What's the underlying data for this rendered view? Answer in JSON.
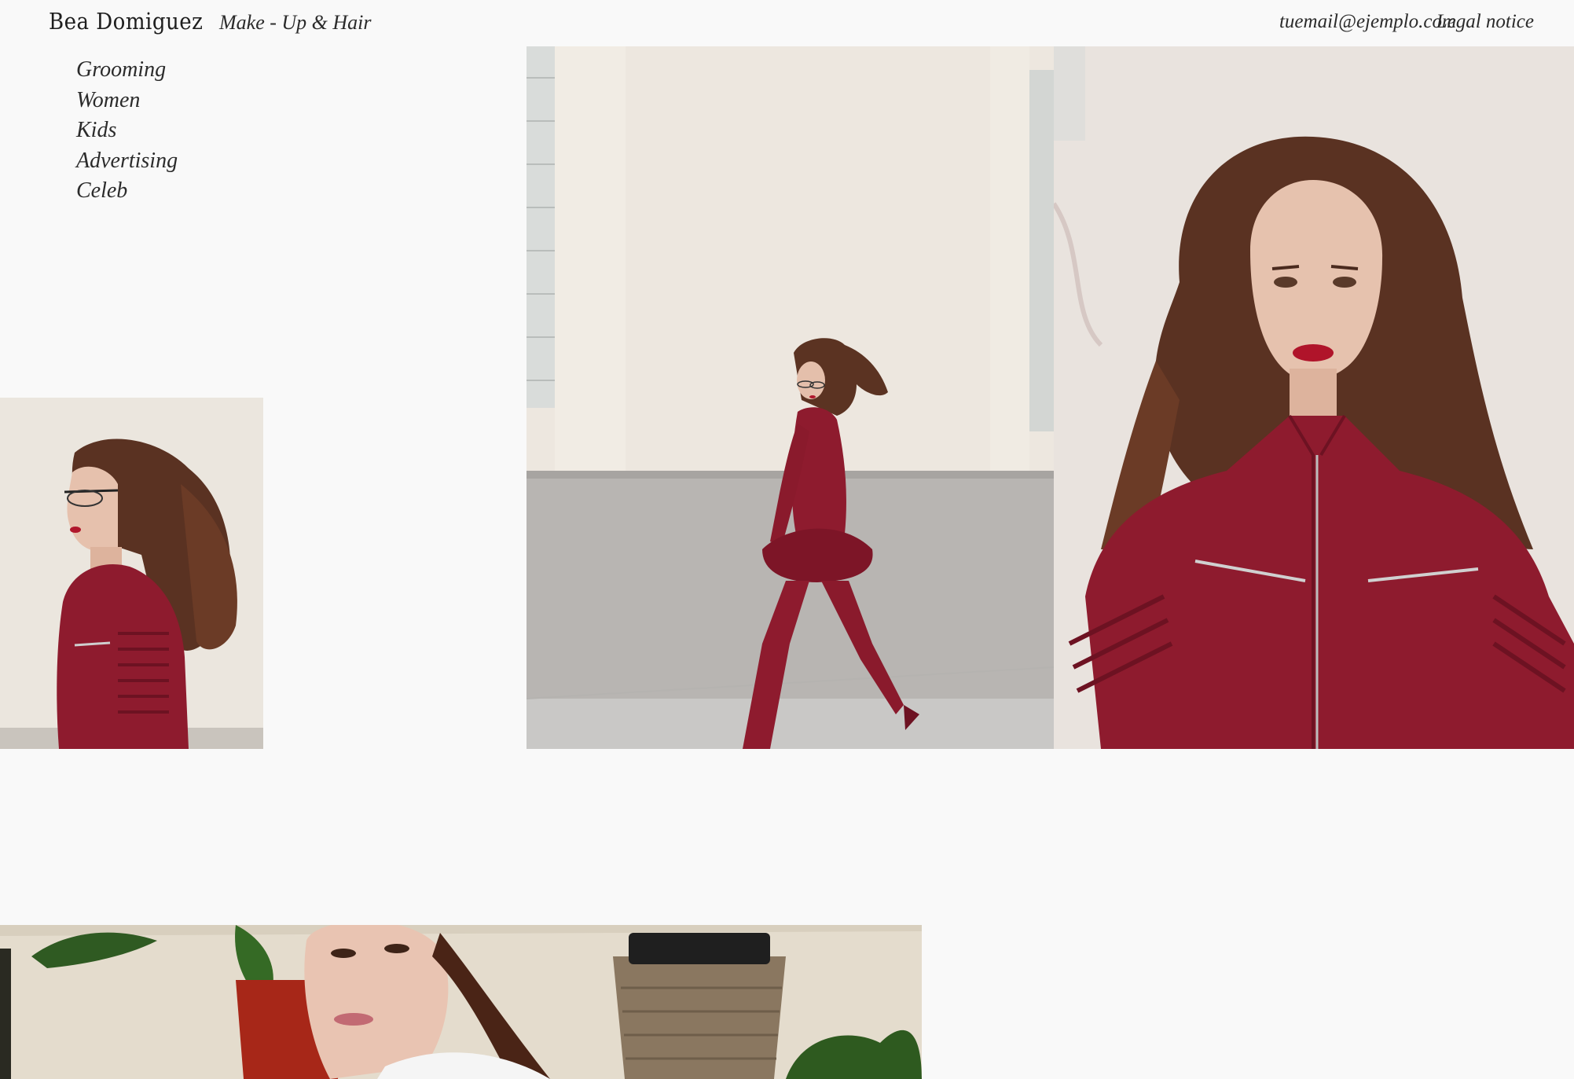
{
  "header": {
    "brand": "Bea Domiguez",
    "tagline": "Make - Up & Hair",
    "email": "tuemail@ejemplo.com",
    "legal": "Legal notice"
  },
  "nav": {
    "items": [
      {
        "label": "Grooming"
      },
      {
        "label": "Women"
      },
      {
        "label": "Kids"
      },
      {
        "label": "Advertising"
      },
      {
        "label": "Celeb"
      }
    ]
  },
  "colors": {
    "background": "#f9f9f9",
    "text": "#2b2b2b",
    "leather_red": "#8e1b2e",
    "wall_cream": "#ece7df",
    "hair_brown": "#5a3222"
  }
}
